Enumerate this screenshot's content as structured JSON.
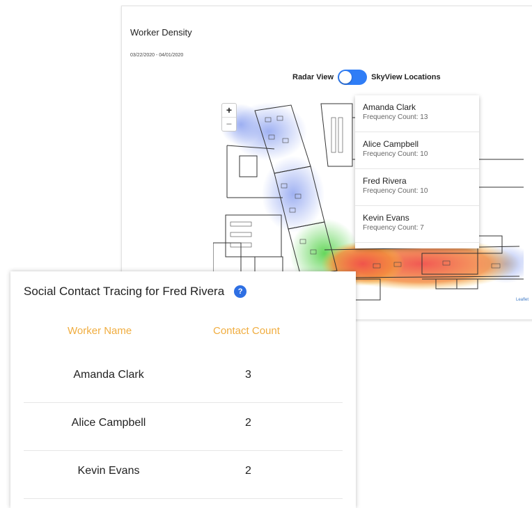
{
  "density": {
    "title": "Worker Density",
    "date_range": "03/22/2020 - 04/01/2020",
    "toggle_left_label": "Radar View",
    "toggle_right_label": "SkyView Locations",
    "zoom_in": "+",
    "zoom_out": "−",
    "attribution": "Leaflet"
  },
  "frequency_list": [
    {
      "name": "Amanda Clark",
      "count": "Frequency Count: 13"
    },
    {
      "name": "Alice Campbell",
      "count": "Frequency Count: 10"
    },
    {
      "name": "Fred Rivera",
      "count": "Frequency Count: 10"
    },
    {
      "name": "Kevin Evans",
      "count": "Frequency Count: 7"
    }
  ],
  "tracing": {
    "title": "Social Contact Tracing for Fred Rivera",
    "help": "?",
    "headers": {
      "name": "Worker Name",
      "count": "Contact Count"
    },
    "rows": [
      {
        "name": "Amanda Clark",
        "count": "3"
      },
      {
        "name": "Alice Campbell",
        "count": "2"
      },
      {
        "name": "Kevin Evans",
        "count": "2"
      }
    ]
  },
  "colors": {
    "accent": "#2f7df6",
    "header_orange": "#f0ad40",
    "heat_red": "#f0504a",
    "heat_green": "#55d24a",
    "heat_blue": "#8fa4f0"
  }
}
